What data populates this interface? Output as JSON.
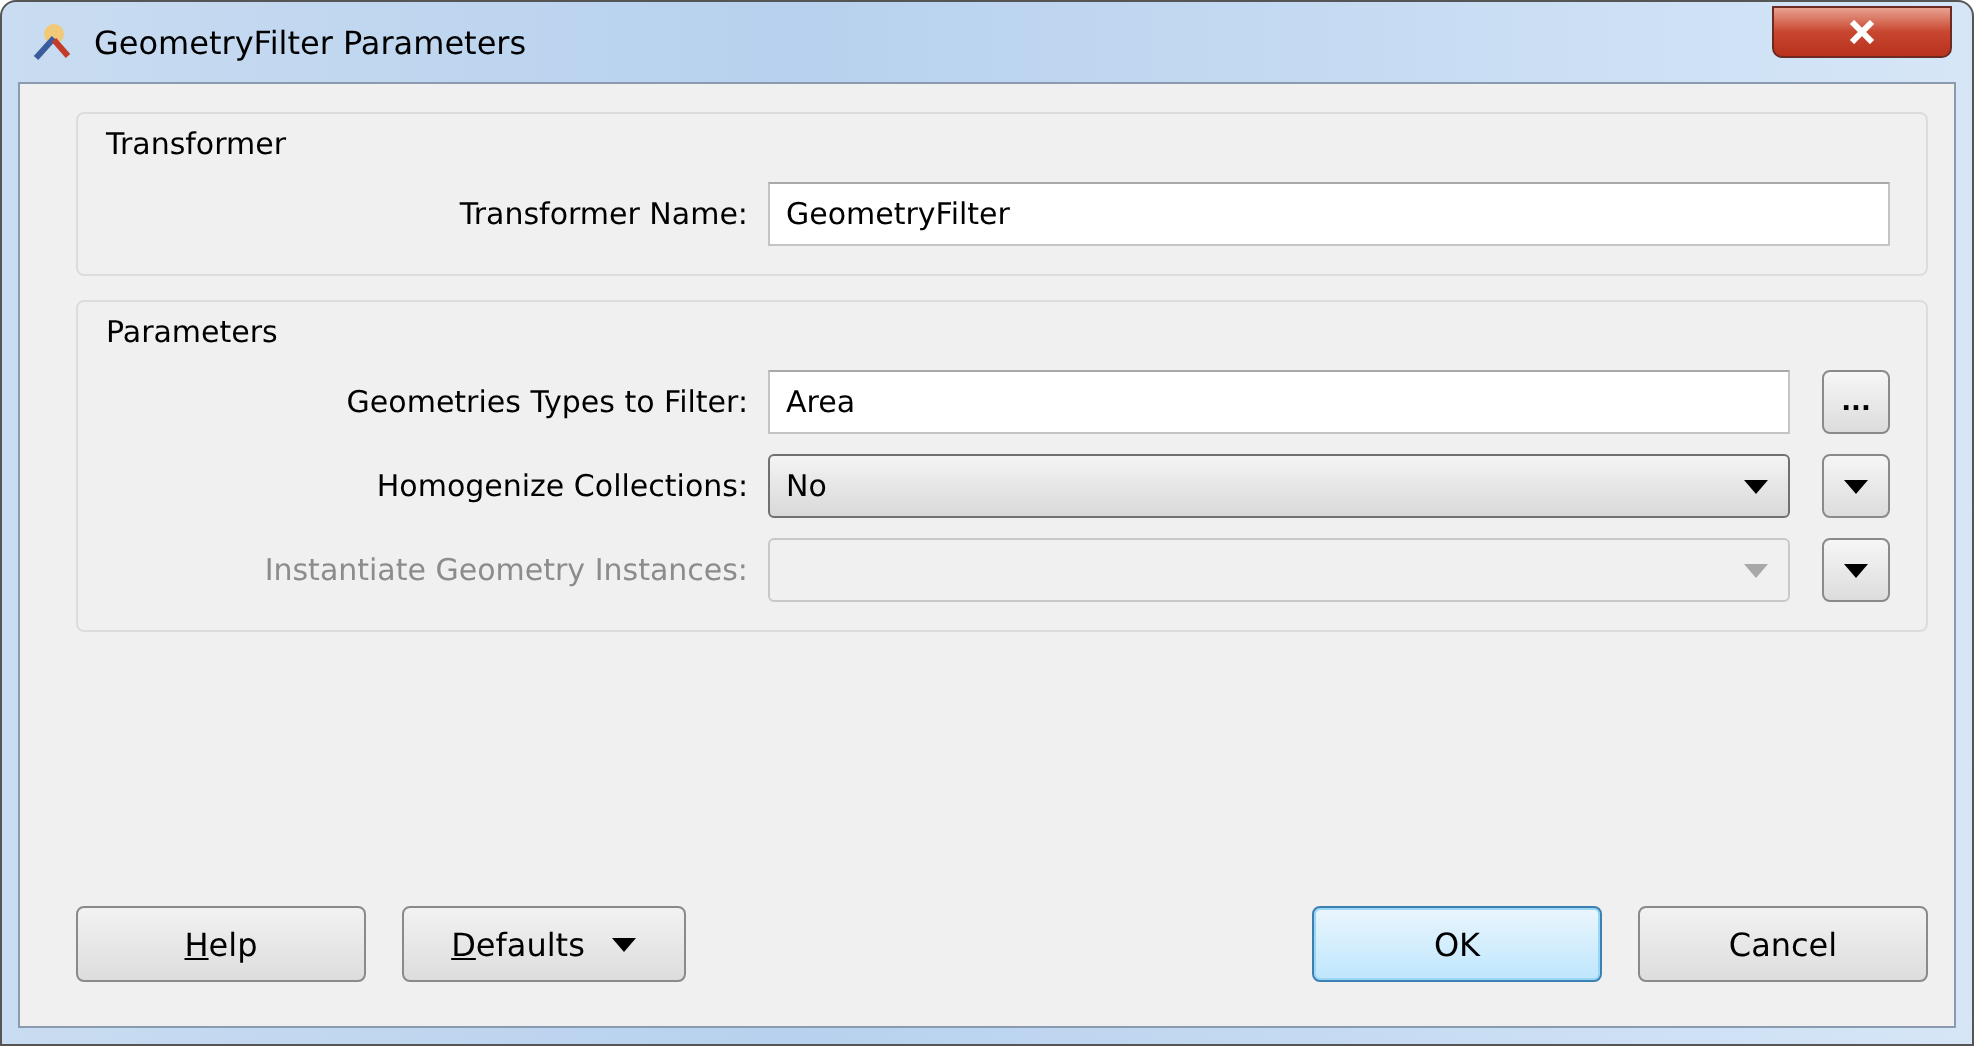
{
  "window": {
    "title": "GeometryFilter Parameters"
  },
  "groups": [
    {
      "title": "Transformer",
      "rows": [
        {
          "label": "Transformer Name:",
          "kind": "text",
          "value": "GeometryFilter",
          "disabled": false
        }
      ]
    },
    {
      "title": "Parameters",
      "rows": [
        {
          "label": "Geometries Types to Filter:",
          "kind": "text",
          "value": "Area",
          "disabled": false,
          "side_button": "..."
        },
        {
          "label": "Homogenize Collections:",
          "kind": "select",
          "value": "No",
          "disabled": false,
          "side_menu": true
        },
        {
          "label": "Instantiate Geometry Instances:",
          "kind": "select",
          "disabled": true,
          "side_menu": true
        }
      ]
    }
  ],
  "buttons": [
    {
      "label": "Help",
      "kind": "plain",
      "default": false
    },
    {
      "label": "Defaults",
      "kind": "menu",
      "default": false
    },
    {
      "label": "OK",
      "kind": "plain",
      "default": true
    },
    {
      "label": "Cancel",
      "kind": "plain",
      "default": false
    }
  ]
}
